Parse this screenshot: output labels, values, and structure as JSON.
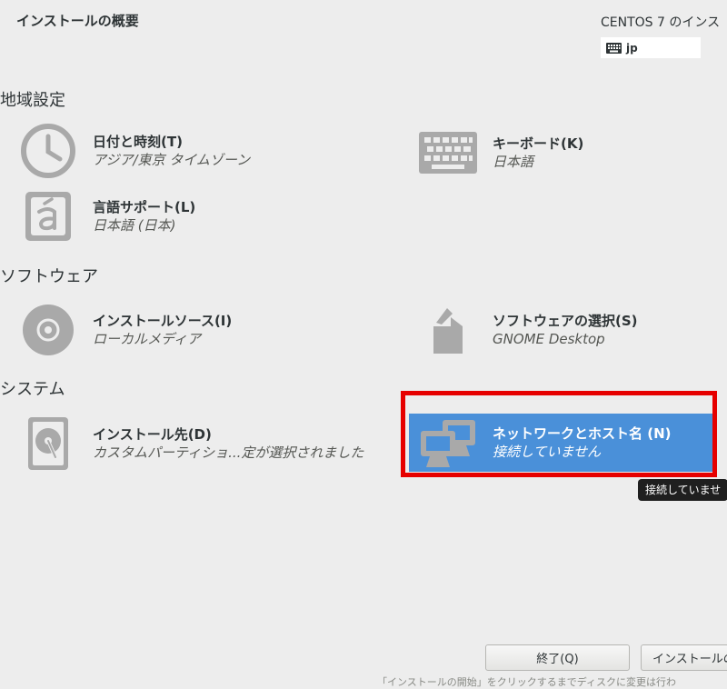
{
  "header": {
    "title": "インストールの概要",
    "product": "CENTOS 7 のインス",
    "keyboard_layout": "jp"
  },
  "sections": {
    "localization": "地域設定",
    "software": "ソフトウェア",
    "system": "システム"
  },
  "spokes": {
    "datetime": {
      "title": "日付と時刻(T)",
      "status": "アジア/東京 タイムゾーン"
    },
    "keyboard": {
      "title": "キーボード(K)",
      "status": "日本語"
    },
    "language": {
      "title": "言語サポート(L)",
      "status": "日本語 (日本)"
    },
    "source": {
      "title": "インストールソース(I)",
      "status": "ローカルメディア"
    },
    "software": {
      "title": "ソフトウェアの選択(S)",
      "status": "GNOME Desktop"
    },
    "destination": {
      "title": "インストール先(D)",
      "status": "カスタムパーティショ...定が選択されました"
    },
    "network": {
      "title": "ネットワークとホスト名 (N)",
      "status": "接続していません"
    }
  },
  "tooltip": "接続していませ",
  "buttons": {
    "quit": "終了(Q)",
    "begin": "インストールの"
  },
  "footer_note": "「インストールの開始」をクリックするまでディスクに変更は行わ",
  "colors": {
    "background": "#ededed",
    "selected": "#4a90d9",
    "highlight": "#e60000",
    "icon": "#a9a9a9"
  }
}
